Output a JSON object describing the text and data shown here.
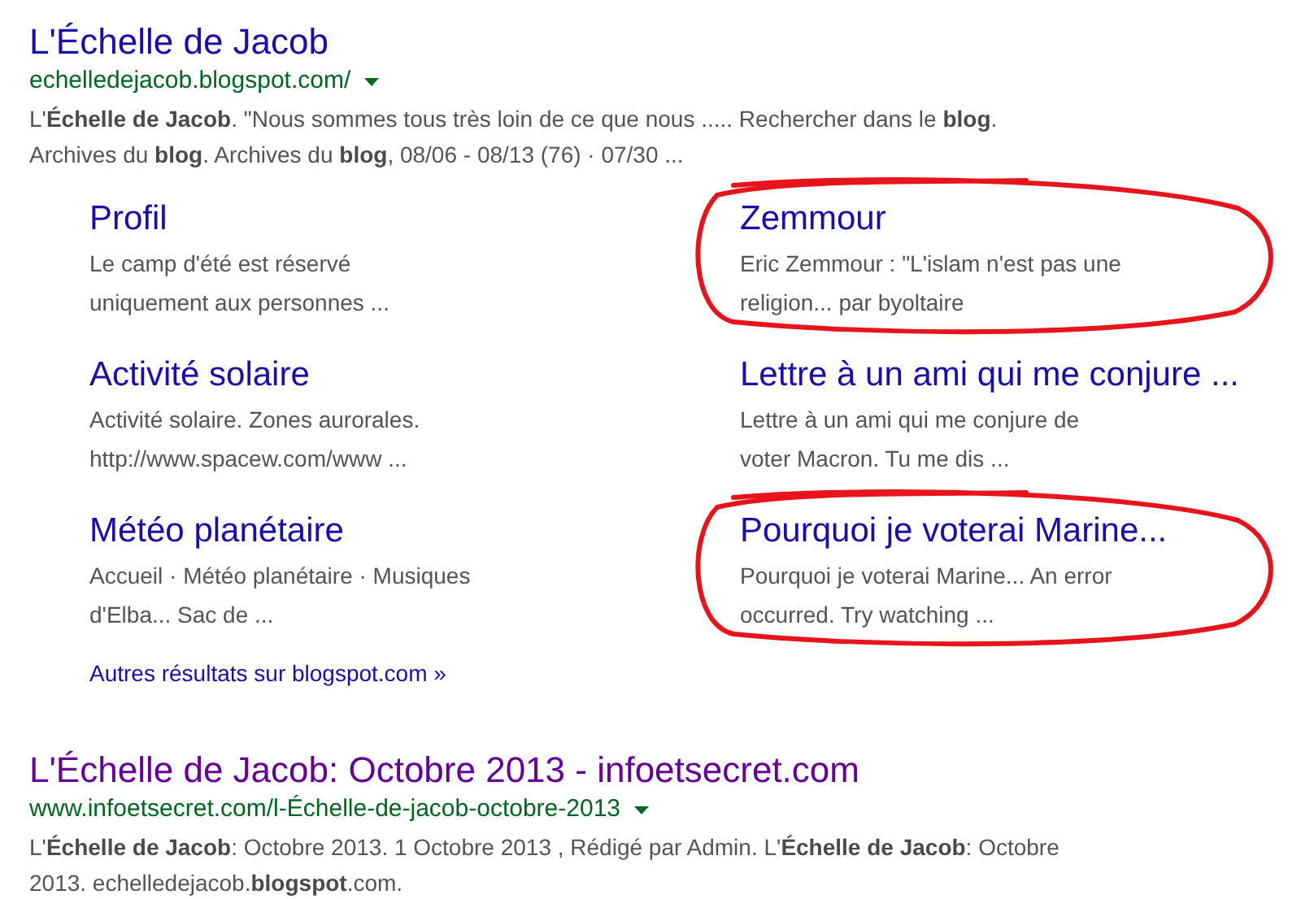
{
  "results": [
    {
      "title": "L'Échelle de Jacob",
      "visited": false,
      "url": "echelledejacob.blogspot.com/",
      "snippet_lines": [
        "L'**Échelle de Jacob**. \"Nous sommes tous très loin de ce que nous ..... Rechercher dans le **blog**.",
        "Archives du **blog**. Archives du **blog**, 08/06 - 08/13 (76) · 07/30 ..."
      ],
      "sitelinks": [
        {
          "title": "Profil",
          "snippet_lines": [
            "Le camp d'été est réservé",
            "uniquement aux personnes ..."
          ],
          "circled": false
        },
        {
          "title": "Zemmour",
          "snippet_lines": [
            "Eric Zemmour : \"L'islam n'est pas une",
            "religion... par byoltaire"
          ],
          "circled": true
        },
        {
          "title": "Activité solaire",
          "snippet_lines": [
            "Activité solaire. Zones aurorales.",
            "http://www.spacew.com/www ..."
          ],
          "circled": false
        },
        {
          "title": "Lettre à un ami qui me conjure ...",
          "snippet_lines": [
            "Lettre à un ami qui me conjure de",
            "voter Macron. Tu me dis ..."
          ],
          "circled": false
        },
        {
          "title": "Météo planétaire",
          "snippet_lines": [
            "Accueil · Météo planétaire · Musiques",
            "d'Elba... Sac de ..."
          ],
          "circled": false
        },
        {
          "title": "Pourquoi je voterai Marine...",
          "snippet_lines": [
            "Pourquoi je voterai Marine... An error",
            "occurred. Try watching ..."
          ],
          "circled": true
        }
      ],
      "more_link": "Autres résultats sur blogspot.com »"
    },
    {
      "title": "L'Échelle de Jacob: Octobre 2013 - infoetsecret.com",
      "visited": true,
      "url": "www.infoetsecret.com/l-Échelle-de-jacob-octobre-2013",
      "snippet_lines": [
        "L'**Échelle de Jacob**: Octobre 2013. 1 Octobre 2013 , Rédigé par Admin. L'**Échelle de Jacob**: Octobre",
        "2013. echelledejacob.**blogspot**.com."
      ]
    }
  ]
}
